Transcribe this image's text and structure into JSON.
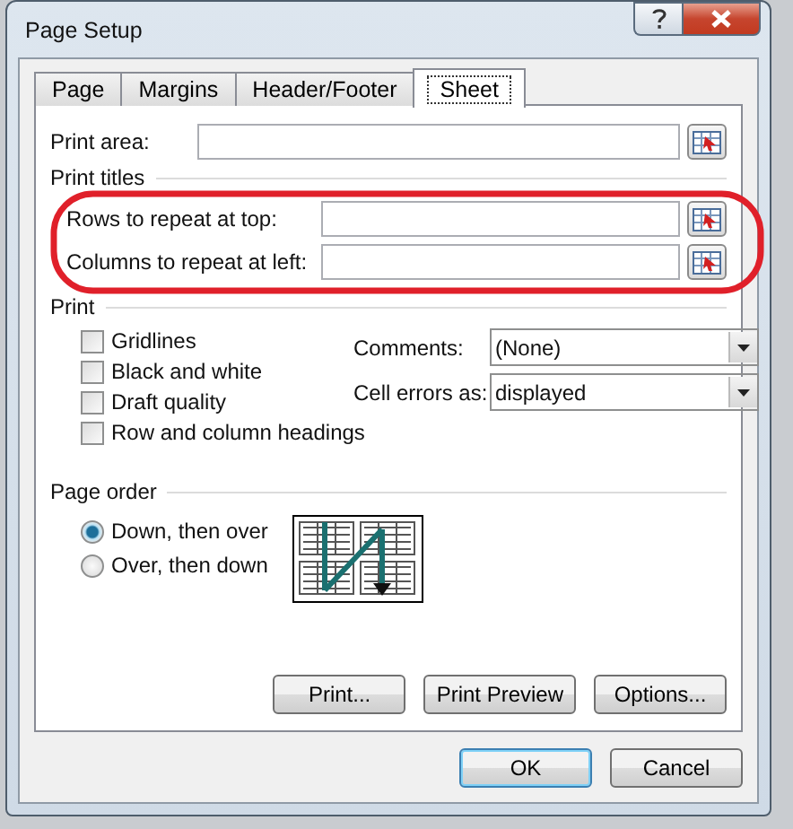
{
  "window": {
    "title": "Page Setup"
  },
  "tabs": [
    {
      "label": "Page",
      "selected": false
    },
    {
      "label": "Margins",
      "selected": false
    },
    {
      "label": "Header/Footer",
      "selected": false
    },
    {
      "label": "Sheet",
      "selected": true
    }
  ],
  "print_area": {
    "label": "Print area:"
  },
  "print_titles": {
    "heading": "Print titles",
    "highlighted": true,
    "fields": [
      {
        "label": "Rows to repeat at top:"
      },
      {
        "label": "Columns to repeat at left:"
      }
    ]
  },
  "print": {
    "heading": "Print",
    "options": [
      {
        "label": "Gridlines",
        "checked": false
      },
      {
        "label": "Black and white",
        "checked": false
      },
      {
        "label": "Draft quality",
        "checked": false
      },
      {
        "label": "Row and column headings",
        "checked": false
      }
    ],
    "dropdowns": [
      {
        "label": "Comments:",
        "value": "(None)"
      },
      {
        "label": "Cell errors as:",
        "value": "displayed"
      }
    ]
  },
  "page_order": {
    "heading": "Page order",
    "options": [
      {
        "label": "Down, then over",
        "selected": true
      },
      {
        "label": "Over, then down",
        "selected": false
      }
    ]
  },
  "panel_buttons": [
    "Print...",
    "Print Preview",
    "Options..."
  ],
  "dialog_buttons": [
    {
      "label": "OK",
      "default": true
    },
    {
      "label": "Cancel",
      "default": false
    }
  ]
}
